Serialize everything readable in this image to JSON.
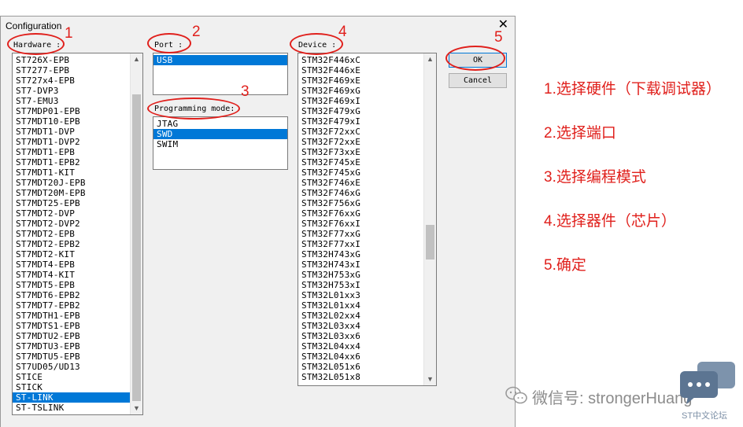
{
  "dialog": {
    "title": "Configuration",
    "close_glyph": "✕",
    "hardware": {
      "label": "Hardware :",
      "items": [
        "ST726X-EPB",
        "ST7277-EPB",
        "ST727x4-EPB",
        "ST7-DVP3",
        "ST7-EMU3",
        "ST7MDP01-EPB",
        "ST7MDT10-EPB",
        "ST7MDT1-DVP",
        "ST7MDT1-DVP2",
        "ST7MDT1-EPB",
        "ST7MDT1-EPB2",
        "ST7MDT1-KIT",
        "ST7MDT20J-EPB",
        "ST7MDT20M-EPB",
        "ST7MDT25-EPB",
        "ST7MDT2-DVP",
        "ST7MDT2-DVP2",
        "ST7MDT2-EPB",
        "ST7MDT2-EPB2",
        "ST7MDT2-KIT",
        "ST7MDT4-EPB",
        "ST7MDT4-KIT",
        "ST7MDT5-EPB",
        "ST7MDT6-EPB2",
        "ST7MDT7-EPB2",
        "ST7MDTH1-EPB",
        "ST7MDTS1-EPB",
        "ST7MDTU2-EPB",
        "ST7MDTU3-EPB",
        "ST7MDTU5-EPB",
        "ST7UD05/UD13",
        "STICE",
        "STICK",
        "ST-LINK",
        "ST-TSLINK"
      ],
      "selected": "ST-LINK"
    },
    "port": {
      "label": "Port :",
      "items": [
        "USB"
      ],
      "selected": "USB"
    },
    "programming_mode": {
      "label": "Programming mode:",
      "items": [
        "JTAG",
        "SWD",
        "SWIM"
      ],
      "selected": "SWD"
    },
    "device": {
      "label": "Device :",
      "items": [
        "STM32F446xC",
        "STM32F446xE",
        "STM32F469xE",
        "STM32F469xG",
        "STM32F469xI",
        "STM32F479xG",
        "STM32F479xI",
        "STM32F72xxC",
        "STM32F72xxE",
        "STM32F73xxE",
        "STM32F745xE",
        "STM32F745xG",
        "STM32F746xE",
        "STM32F746xG",
        "STM32F756xG",
        "STM32F76xxG",
        "STM32F76xxI",
        "STM32F77xxG",
        "STM32F77xxI",
        "STM32H743xG",
        "STM32H743xI",
        "STM32H753xG",
        "STM32H753xI",
        "STM32L01xx3",
        "STM32L01xx4",
        "STM32L02xx4",
        "STM32L03xx4",
        "STM32L03xx6",
        "STM32L04xx4",
        "STM32L04xx6",
        "STM32L051x6",
        "STM32L051x8"
      ]
    },
    "ok_label": "OK",
    "cancel_label": "Cancel"
  },
  "annotations": {
    "numbers": [
      "1",
      "2",
      "3",
      "4",
      "5"
    ],
    "steps": [
      "1.选择硬件（下载调试器）",
      "2.选择端口",
      "3.选择编程模式",
      "4.选择器件（芯片）",
      "5.确定"
    ],
    "color": "#e0201c"
  },
  "watermark": {
    "text": "微信号: strongerHuang",
    "sub": "ST中文论坛"
  }
}
